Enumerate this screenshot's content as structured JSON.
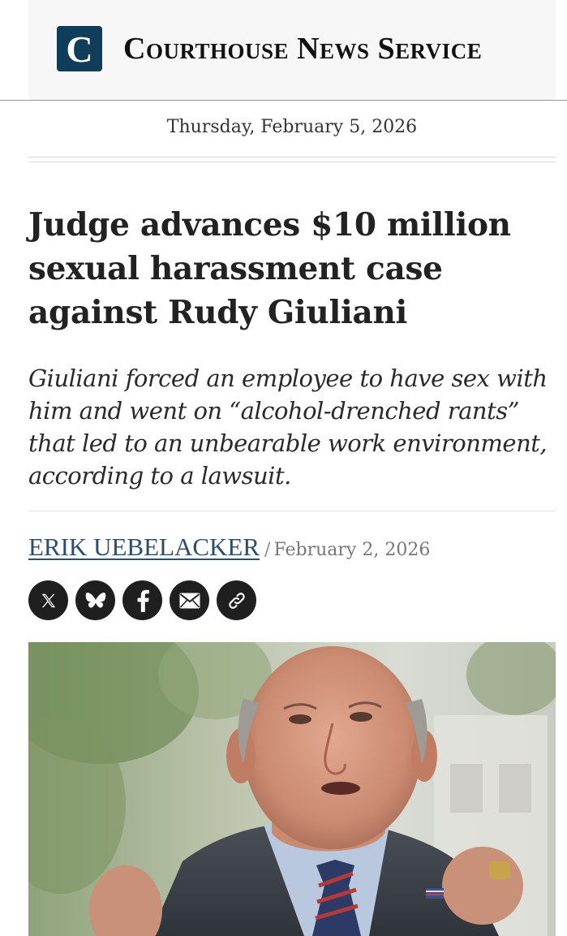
{
  "masthead": {
    "logo_letter": "C",
    "site_name": "Courthouse News Service"
  },
  "dateline": "Thursday, February 5, 2026",
  "article": {
    "headline": "Judge advances $10 million sexual harassment case against Rudy Giuliani",
    "deck": "Giuliani forced an employee to have sex with him and went on “alcohol-drenched rants” that led to an unbearable work environment, according to a lawsuit.",
    "author": "ERIK UEBELACKER",
    "separator": "/",
    "published": "February 2, 2026"
  },
  "share": [
    {
      "name": "x-share-button",
      "icon": "x-icon"
    },
    {
      "name": "bluesky-share-button",
      "icon": "bluesky-butterfly-icon"
    },
    {
      "name": "facebook-share-button",
      "icon": "facebook-icon"
    },
    {
      "name": "email-share-button",
      "icon": "envelope-icon"
    },
    {
      "name": "copy-link-button",
      "icon": "link-icon"
    }
  ],
  "colors": {
    "brand": "#0f3d5a",
    "author_link": "#2b4d6e",
    "share_bg": "#1f1f1f"
  }
}
